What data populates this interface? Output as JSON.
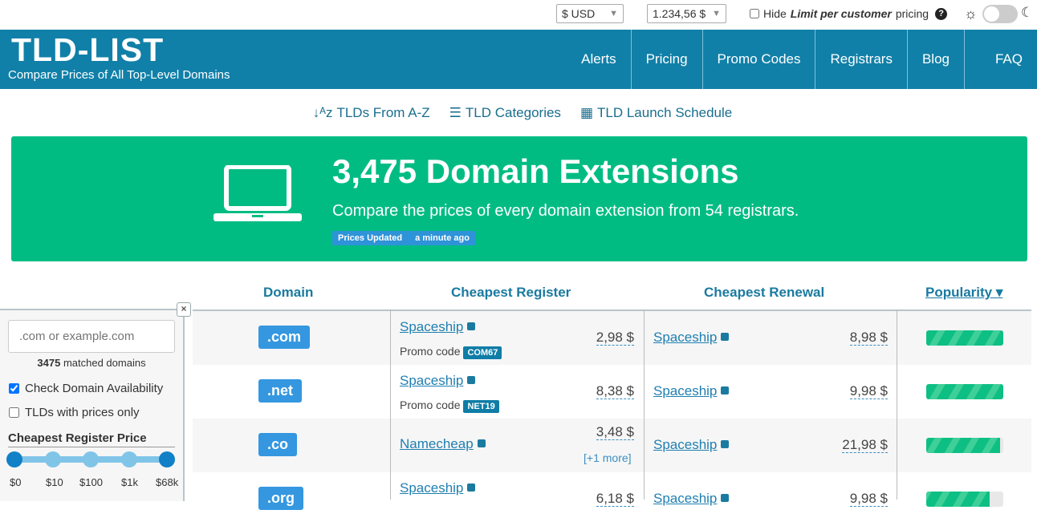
{
  "topbar": {
    "currency": "$ USD",
    "format": "1.234,56 $",
    "hide_prefix": "Hide",
    "hide_bold": "Limit per customer",
    "hide_suffix": "pricing",
    "help": "?"
  },
  "header": {
    "logo": "TLD-LIST",
    "tagline": "Compare Prices of All Top-Level Domains",
    "nav": [
      "Alerts",
      "Pricing",
      "Promo Codes",
      "Registrars",
      "Blog",
      "FAQ"
    ]
  },
  "subnav": [
    "TLDs From A-Z",
    "TLD Categories",
    "TLD Launch Schedule"
  ],
  "banner": {
    "title": "3,475 Domain Extensions",
    "subtitle": "Compare the prices of every domain extension from 54 registrars.",
    "badge_label": "Prices Updated",
    "badge_time": "a minute ago"
  },
  "table": {
    "headers": [
      "Domain",
      "Cheapest Register",
      "Cheapest Renewal",
      "Popularity ▾"
    ],
    "promo_label": "Promo code",
    "rows": [
      {
        "tld": ".com",
        "reg": "Spaceship",
        "reg_price": "2,98 $",
        "promo": "COM67",
        "ren": "Spaceship",
        "ren_price": "8,98 $",
        "popularity": 100
      },
      {
        "tld": ".net",
        "reg": "Spaceship",
        "reg_price": "8,38 $",
        "promo": "NET19",
        "ren": "Spaceship",
        "ren_price": "9,98 $",
        "popularity": 100
      },
      {
        "tld": ".co",
        "reg": "Namecheap",
        "reg_price": "3,48 $",
        "more": "[+1 more]",
        "ren": "Spaceship",
        "ren_price": "21,98 $",
        "popularity": 96
      },
      {
        "tld": ".org",
        "reg": "Spaceship",
        "reg_price": "6,18 $",
        "ren": "Spaceship",
        "ren_price": "9,98 $",
        "popularity": 82
      }
    ]
  },
  "filter": {
    "placeholder": ".com or example.com",
    "matched_count": "3475",
    "matched_text": "matched domains",
    "check_availability": "Check Domain Availability",
    "prices_only": "TLDs with prices only",
    "price_title": "Cheapest Register Price",
    "ticks": [
      "$0",
      "$10",
      "$100",
      "$1k",
      "$68k"
    ],
    "close": "×"
  }
}
